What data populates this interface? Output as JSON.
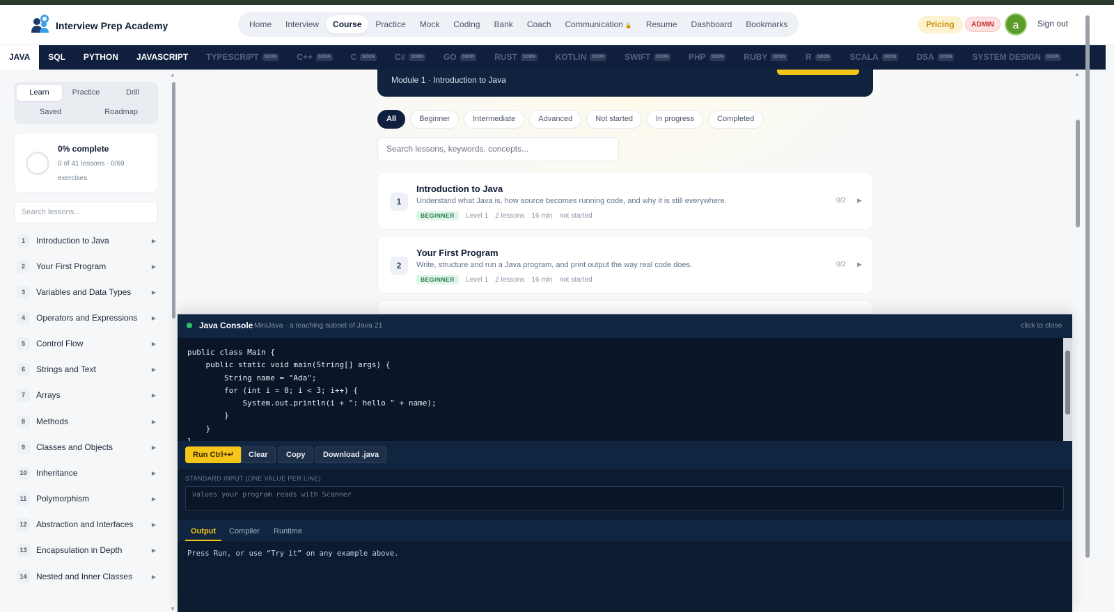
{
  "header": {
    "brand": "Interview Prep Academy",
    "nav": [
      {
        "label": "Home",
        "lock": ""
      },
      {
        "label": "Interview",
        "lock": ""
      },
      {
        "label": "Course",
        "lock": "",
        "active": true
      },
      {
        "label": "Practice",
        "lock": ""
      },
      {
        "label": "Mock",
        "lock": ""
      },
      {
        "label": "Coding",
        "lock": ""
      },
      {
        "label": "Bank",
        "lock": ""
      },
      {
        "label": "Coach",
        "lock": ""
      },
      {
        "label": "Communication",
        "lock": "🔒"
      },
      {
        "label": "Resume",
        "lock": ""
      },
      {
        "label": "Dashboard",
        "lock": ""
      },
      {
        "label": "Bookmarks",
        "lock": ""
      }
    ],
    "pricing": "Pricing",
    "admin": "ADMIN",
    "avatar": "a",
    "signout": "Sign out"
  },
  "languages": [
    {
      "label": "JAVA",
      "soon": "",
      "active": true
    },
    {
      "label": "SQL",
      "soon": ""
    },
    {
      "label": "PYTHON",
      "soon": ""
    },
    {
      "label": "JAVASCRIPT",
      "soon": ""
    },
    {
      "label": "TYPESCRIPT",
      "soon": "SOON"
    },
    {
      "label": "C++",
      "soon": "SOON"
    },
    {
      "label": "C",
      "soon": "SOON"
    },
    {
      "label": "C#",
      "soon": "SOON"
    },
    {
      "label": "GO",
      "soon": "SOON"
    },
    {
      "label": "RUST",
      "soon": "SOON"
    },
    {
      "label": "KOTLIN",
      "soon": "SOON"
    },
    {
      "label": "SWIFT",
      "soon": "SOON"
    },
    {
      "label": "PHP",
      "soon": "SOON"
    },
    {
      "label": "RUBY",
      "soon": "SOON"
    },
    {
      "label": "R",
      "soon": "SOON"
    },
    {
      "label": "SCALA",
      "soon": "SOON"
    },
    {
      "label": "DSA",
      "soon": "SOON"
    },
    {
      "label": "SYSTEM DESIGN",
      "soon": "SOON"
    }
  ],
  "sidebar": {
    "tabs": [
      "Learn",
      "Practice",
      "Drill",
      "Saved",
      "Roadmap"
    ],
    "progress": {
      "title": "0% complete",
      "sub": "0 of 41 lessons · 0/69 exercises",
      "percent": 0
    },
    "search_placeholder": "Search lessons...",
    "lessons": [
      {
        "num": "1",
        "title": "Introduction to Java"
      },
      {
        "num": "2",
        "title": "Your First Program"
      },
      {
        "num": "3",
        "title": "Variables and Data Types"
      },
      {
        "num": "4",
        "title": "Operators and Expressions"
      },
      {
        "num": "5",
        "title": "Control Flow"
      },
      {
        "num": "6",
        "title": "Strings and Text"
      },
      {
        "num": "7",
        "title": "Arrays"
      },
      {
        "num": "8",
        "title": "Methods"
      },
      {
        "num": "9",
        "title": "Classes and Objects"
      },
      {
        "num": "10",
        "title": "Inheritance"
      },
      {
        "num": "11",
        "title": "Polymorphism"
      },
      {
        "num": "12",
        "title": "Abstraction and Interfaces"
      },
      {
        "num": "13",
        "title": "Encapsulation in Depth"
      },
      {
        "num": "14",
        "title": "Nested and Inner Classes"
      }
    ]
  },
  "main": {
    "module_banner": "Module 1 · Introduction to Java",
    "filters": [
      "All",
      "Beginner",
      "Intermediate",
      "Advanced",
      "Not started",
      "In progress",
      "Completed"
    ],
    "search_placeholder": "Search lessons, keywords, concepts...",
    "modules": [
      {
        "num": "1",
        "title": "Introduction to Java",
        "desc": "Understand what Java is, how source becomes running code, and why it is still everywhere.",
        "badge": "BEGINNER",
        "level": "Level 1",
        "lessons": "2 lessons",
        "time": "16 min",
        "status": "not started",
        "count": "0/2"
      },
      {
        "num": "2",
        "title": "Your First Program",
        "desc": "Write, structure and run a Java program, and print output the way real code does.",
        "badge": "BEGINNER",
        "level": "Level 1",
        "lessons": "2 lessons",
        "time": "16 min",
        "status": "not started",
        "count": "0/2"
      }
    ]
  },
  "console": {
    "title": "Java Console",
    "subtitle": "MiniJava · a teaching subset of Java 21",
    "close": "click to close",
    "code": "public class Main {\n    public static void main(String[] args) {\n        String name = \"Ada\";\n        for (int i = 0; i < 3; i++) {\n            System.out.println(i + \": hello \" + name);\n        }\n    }\n}",
    "buttons": {
      "run": "Run Ctrl+↵",
      "clear": "Clear",
      "copy": "Copy",
      "download": "Download .java"
    },
    "stdin_label": "STANDARD INPUT (ONE VALUE PER LINE)",
    "stdin_placeholder": "values your program reads with Scanner",
    "out_tabs": [
      "Output",
      "Compiler",
      "Runtime"
    ],
    "output": "Press Run, or use “Try it” on any example above."
  }
}
